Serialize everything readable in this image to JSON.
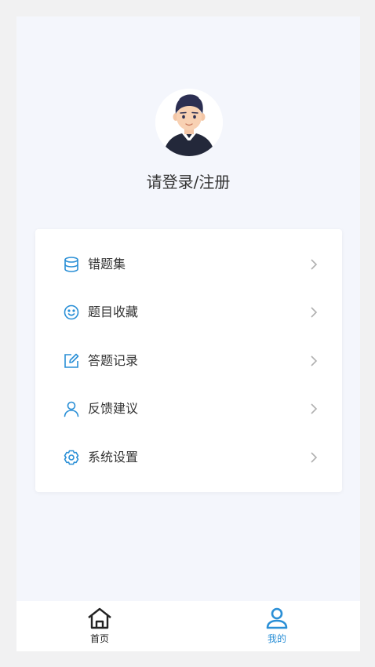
{
  "profile": {
    "login_label": "请登录/注册"
  },
  "menu": {
    "items": [
      {
        "label": "错题集",
        "icon": "database-icon"
      },
      {
        "label": "题目收藏",
        "icon": "smiley-icon"
      },
      {
        "label": "答题记录",
        "icon": "edit-icon"
      },
      {
        "label": "反馈建议",
        "icon": "user-icon"
      },
      {
        "label": "系统设置",
        "icon": "gear-icon"
      }
    ]
  },
  "tabbar": {
    "tabs": [
      {
        "label": "首页",
        "icon": "home-icon",
        "active": false
      },
      {
        "label": "我的",
        "icon": "profile-icon",
        "active": true
      }
    ]
  },
  "colors": {
    "accent": "#2a8fd6",
    "text": "#333333",
    "arrow": "#b0b0b0",
    "page_bg": "#f4f6fc",
    "inactive_tab": "#222222"
  }
}
